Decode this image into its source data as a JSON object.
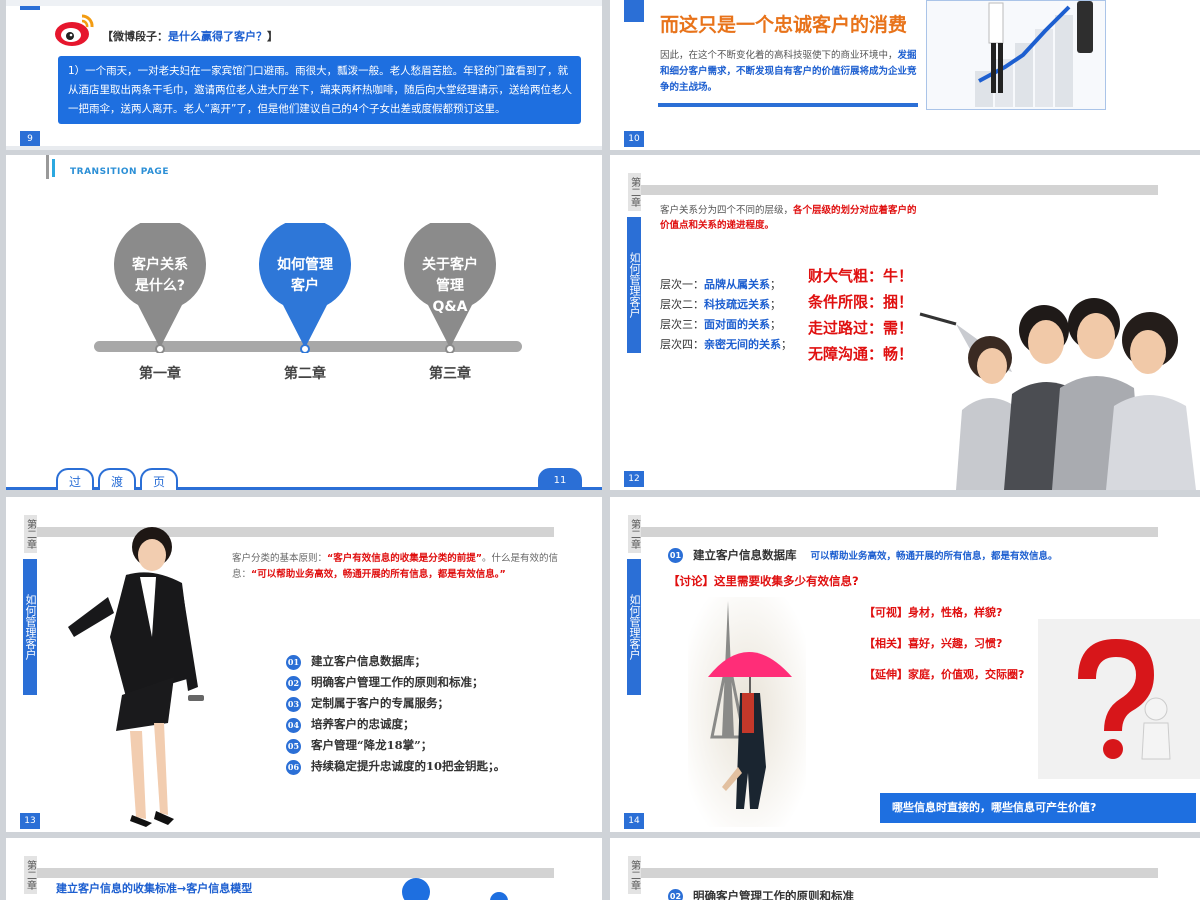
{
  "slide9": {
    "number": "9",
    "header_prefix": "【微博段子：",
    "header_question": "是什么赢得了客户？",
    "header_suffix": "】",
    "story": "1）一个雨天，一对老夫妇在一家宾馆门口避雨。雨很大，瓢泼一般。老人愁眉苦脸。年轻的门童看到了，就从酒店里取出两条干毛巾，邀请两位老人进大厅坐下，端来两杯热咖啡，随后向大堂经理请示，送给两位老人一把雨伞，送两人离开。老人“离开”了，但是他们建议自己的4个子女出差或度假都预订这里。"
  },
  "slide10": {
    "number": "10",
    "title": "而这只是一个忠诚客户的消费",
    "body_line1": "因此，在这个不断变化着的高科技驱使下的商业环境中，",
    "body_bold": "发掘和细分客户需求，不断发现自有客户的价值衍展将成为企业竞争的主战场。"
  },
  "slide11": {
    "number": "11",
    "transition_label": "TRANSITION PAGE",
    "pins": [
      {
        "text": "客户关系\n是什么?",
        "chapter": "第一章"
      },
      {
        "text": "如何管理\n客户",
        "chapter": "第二章"
      },
      {
        "text": "关于客户\n管理\nQ&A",
        "chapter": "第三章"
      }
    ],
    "tabs": [
      "过",
      "渡",
      "页"
    ]
  },
  "slide12": {
    "number": "12",
    "chapter_top": "第二章",
    "chapter_vert": "如何管理客户",
    "intro_plain": "客户关系分为四个不同的层级，",
    "intro_red": "各个层级的划分对应着客户的价值点和关系的递进程度。",
    "levels": [
      {
        "label": "层次一：",
        "name": "品牌从属关系",
        "tail": "；",
        "slogan": "财大气粗：牛！"
      },
      {
        "label": "层次二：",
        "name": "科技疏远关系",
        "tail": "；",
        "slogan": "条件所限：捆！"
      },
      {
        "label": "层次三：",
        "name": "面对面的关系",
        "tail": "；",
        "slogan": "走过路过：需！"
      },
      {
        "label": "层次四：",
        "name": "亲密无间的关系",
        "tail": "；",
        "slogan": "无障沟通：畅！"
      }
    ]
  },
  "slide13": {
    "number": "13",
    "chapter_top": "第二章",
    "chapter_vert": "如何管理客户",
    "principle_plain1": "客户分类的基本原则：",
    "principle_red1": "“客户有效信息的收集是分类的前提”",
    "principle_plain2": "。什么是有效的信息：",
    "principle_red2": "“可以帮助业务高效，畅通开展的所有信息，都是有效信息。”",
    "items": [
      {
        "n": "01",
        "text": "建立客户信息数据库；"
      },
      {
        "n": "02",
        "text": "明确客户管理工作的原则和标准；"
      },
      {
        "n": "03",
        "text": "定制属于客户的专属服务；"
      },
      {
        "n": "04",
        "text": "培养客户的忠诚度；"
      },
      {
        "n": "05",
        "text": "客户管理“降龙18掌”；"
      },
      {
        "n": "06",
        "text": "持续稳定提升忠诚度的10把金钥匙；。"
      }
    ]
  },
  "slide14": {
    "number": "14",
    "chapter_top": "第二章",
    "chapter_vert": "如何管理客户",
    "item_num": "01",
    "item_title": "建立客户信息数据库",
    "item_note": "可以帮助业务高效，畅通开展的所有信息，都是有效信息。",
    "discussion": "【讨论】这里需要收集多少有效信息?",
    "points": [
      {
        "tag": "【可视】",
        "text": "身材，性格，样貌?"
      },
      {
        "tag": "【相关】",
        "text": "喜好，兴趣，习惯?"
      },
      {
        "tag": "【延伸】",
        "text": "家庭，价值观，交际圈?"
      }
    ],
    "bottom_banner": "哪些信息时直接的，哪些信息可产生价值?"
  },
  "slide15": {
    "chapter_top": "第二章",
    "title": "建立客户信息的收集标准→客户信息模型"
  },
  "slide16": {
    "chapter_top": "第二章",
    "item_num": "02",
    "title": "明确客户管理工作的原则和标准"
  },
  "colors": {
    "accent_blue": "#2b6fd6",
    "accent_red": "#e01010",
    "orange": "#e8731a"
  }
}
